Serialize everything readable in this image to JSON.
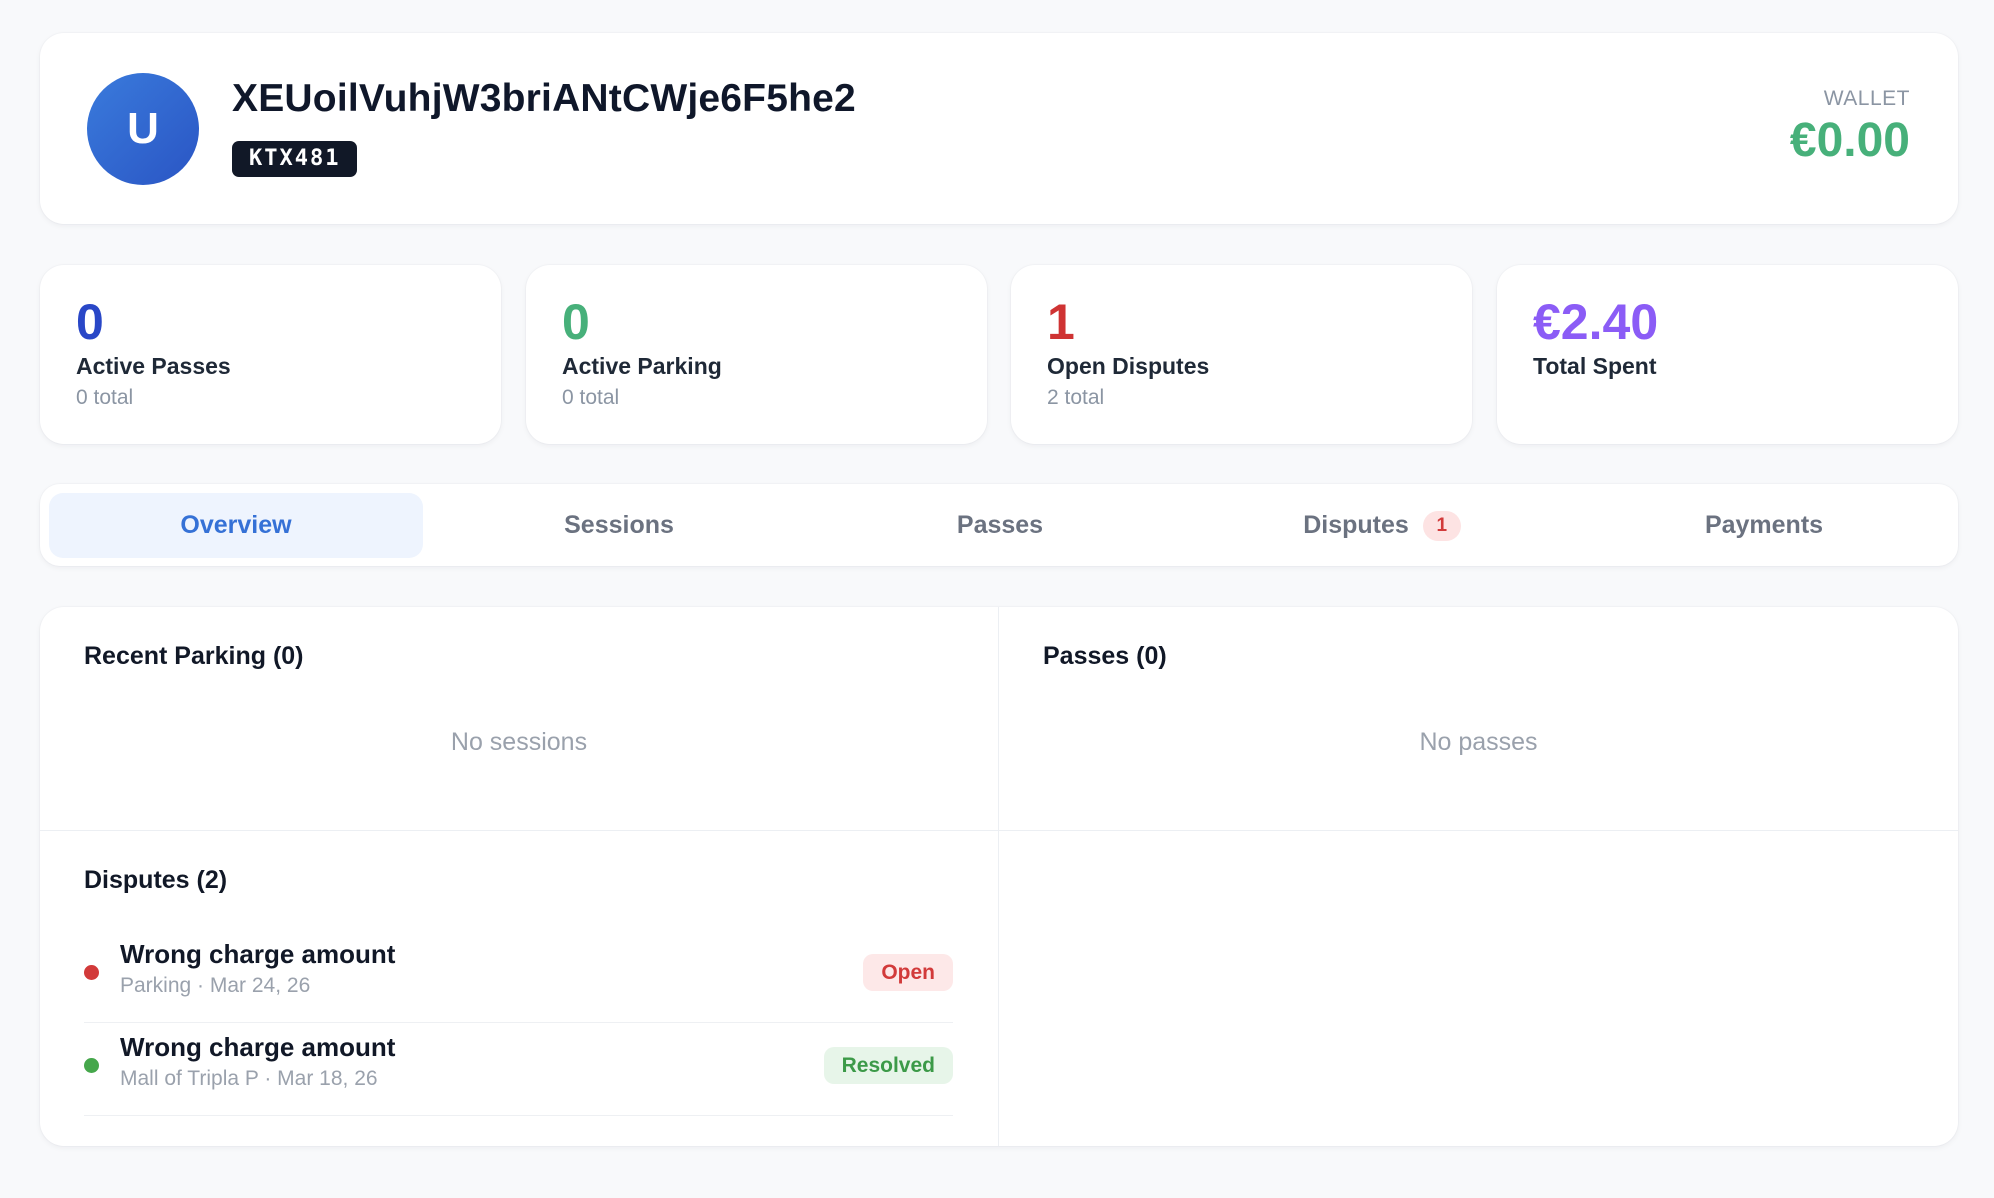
{
  "user": {
    "avatar_initial": "U",
    "name": "XEUoilVuhjW3briANtCWje6F5he2",
    "plate": "KTX481"
  },
  "wallet": {
    "label": "WALLET",
    "amount": "€0.00"
  },
  "stats": [
    {
      "value": "0",
      "label": "Active Passes",
      "sub": "0 total",
      "color": "#2947c7"
    },
    {
      "value": "0",
      "label": "Active Parking",
      "sub": "0 total",
      "color": "#47b07a"
    },
    {
      "value": "1",
      "label": "Open Disputes",
      "sub": "2 total",
      "color": "#cf3333"
    },
    {
      "value": "€2.40",
      "label": "Total Spent",
      "sub": "",
      "color": "#8b5cf6"
    }
  ],
  "tabs": [
    {
      "label": "Overview",
      "active": true
    },
    {
      "label": "Sessions"
    },
    {
      "label": "Passes"
    },
    {
      "label": "Disputes",
      "badge": "1"
    },
    {
      "label": "Payments"
    }
  ],
  "recent_parking": {
    "title": "Recent Parking (0)",
    "empty": "No sessions"
  },
  "passes": {
    "title": "Passes (0)",
    "empty": "No passes"
  },
  "disputes": {
    "title": "Disputes (2)",
    "items": [
      {
        "title": "Wrong charge amount",
        "meta": "Parking · Mar 24, 26",
        "status": "Open",
        "dot_color": "#d23a3a"
      },
      {
        "title": "Wrong charge amount",
        "meta": "Mall of Tripla P · Mar 18, 26",
        "status": "Resolved",
        "dot_color": "#45a74b"
      }
    ]
  },
  "colors": {
    "accent": "#3571d6",
    "open_badge_bg": "#fde8e8",
    "open_badge_fg": "#d23a3a",
    "resolved_badge_bg": "#e7f5e9",
    "resolved_badge_fg": "#3c9a48"
  }
}
